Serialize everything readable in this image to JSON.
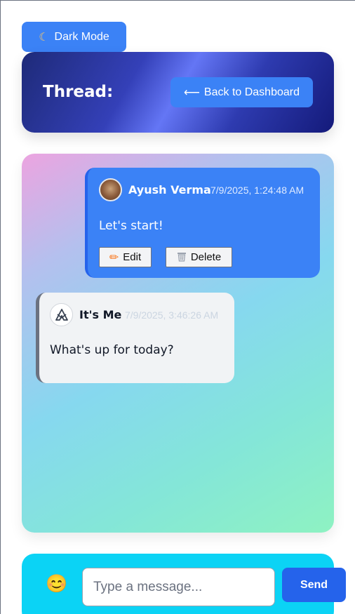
{
  "theme_toggle": {
    "icon": "moon-icon",
    "label": "Dark Mode"
  },
  "header": {
    "title": "Thread:",
    "back_button": {
      "icon": "arrow-left-icon",
      "label": "Back to Dashboard"
    }
  },
  "messages": [
    {
      "author": "Ayush Verma",
      "timestamp": "7/9/2025, 1:24:48 AM",
      "text": "Let's start!",
      "avatar": "user-photo-avatar",
      "own": true,
      "actions": [
        {
          "icon": "pencil-icon",
          "label": "Edit"
        },
        {
          "icon": "trash-icon",
          "label": "Delete"
        }
      ]
    },
    {
      "author": "It's Me",
      "timestamp": "7/9/2025, 3:46:26 AM",
      "text": "What's up for today?",
      "avatar": "logo-avatar",
      "own": false
    }
  ],
  "composer": {
    "emoji_icon": "smiley-emoji-icon",
    "input_value": "",
    "placeholder": "Type a message...",
    "send_label": "Send"
  },
  "colors": {
    "primary": "#3b82f6",
    "send": "#2563eb",
    "composer_bg": "#0bd3f5",
    "own_bubble": "#3b82f6",
    "other_bubble": "#f1f3f5"
  }
}
